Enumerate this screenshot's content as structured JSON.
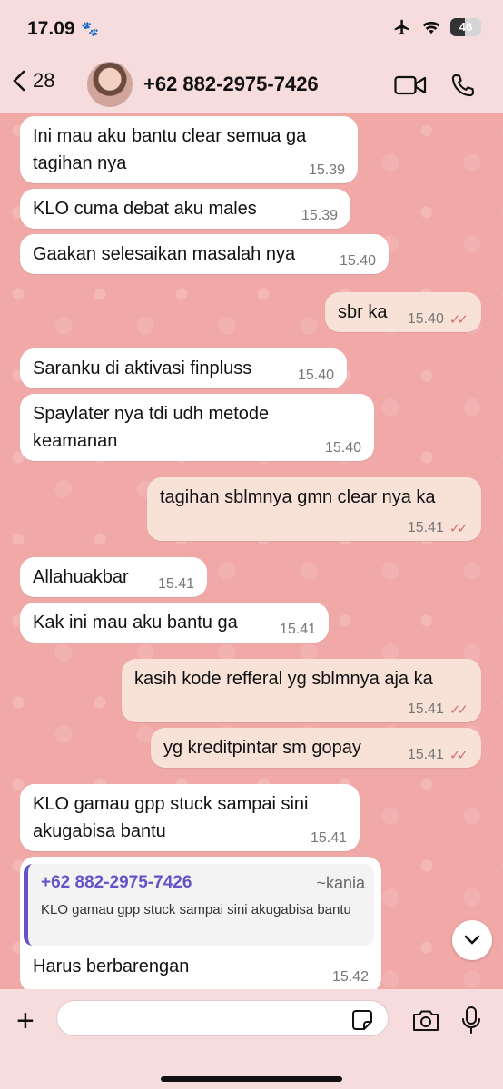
{
  "status": {
    "time": "17.09",
    "battery": "46",
    "battery_level": 0.46
  },
  "header": {
    "back_count": "28",
    "contact": "+62 882-2975-7426"
  },
  "messages": [
    {
      "text": "Ini mau aku bantu clear semua ga\ntagihan nya",
      "time": "15.39",
      "dir": "in"
    },
    {
      "text": "KLO cuma debat aku males",
      "time": "15.39",
      "dir": "in"
    },
    {
      "text": "Gaakan selesaikan masalah nya",
      "time": "15.40",
      "dir": "in"
    },
    {
      "text": "sbr ka",
      "time": "15.40",
      "dir": "out"
    },
    {
      "text": "Saranku di aktivasi finpluss",
      "time": "15.40",
      "dir": "in"
    },
    {
      "text": "Spaylater nya tdi udh metode\nkeamanan",
      "time": "15.40",
      "dir": "in"
    },
    {
      "text": "tagihan sblmnya gmn clear nya ka",
      "time": "15.41",
      "dir": "out"
    },
    {
      "text": "Allahuakbar",
      "time": "15.41",
      "dir": "in"
    },
    {
      "text": "Kak ini mau aku bantu ga",
      "time": "15.41",
      "dir": "in"
    },
    {
      "text": "kasih kode refferal yg sblmnya aja ka",
      "time": "15.41",
      "dir": "out"
    },
    {
      "text": "yg kreditpintar sm gopay",
      "time": "15.41",
      "dir": "out"
    },
    {
      "text": "KLO gamau gpp stuck sampai sini\nakugabisa bantu",
      "time": "15.41",
      "dir": "in"
    },
    {
      "text": "Harus berbarengan",
      "time": "15.42",
      "dir": "in",
      "quote": {
        "name": "+62 882-2975-7426",
        "alias": "~kania",
        "text": "KLO gamau gpp stuck sampai sini akugabisa bantu"
      }
    }
  ],
  "colors": {
    "in_bubble": "#ffffff",
    "out_bubble": "#f8e2d8",
    "chat_bg": "#f1a9a8",
    "ticks": "#d86e6e",
    "quote_accent": "#6653c8"
  },
  "icons": [
    "paw-icon",
    "airplane-icon",
    "wifi-icon",
    "battery-icon",
    "back-chevron-icon",
    "video-call-icon",
    "phone-icon",
    "chevron-down-icon",
    "plus-icon",
    "sticker-icon",
    "camera-icon",
    "mic-icon"
  ]
}
